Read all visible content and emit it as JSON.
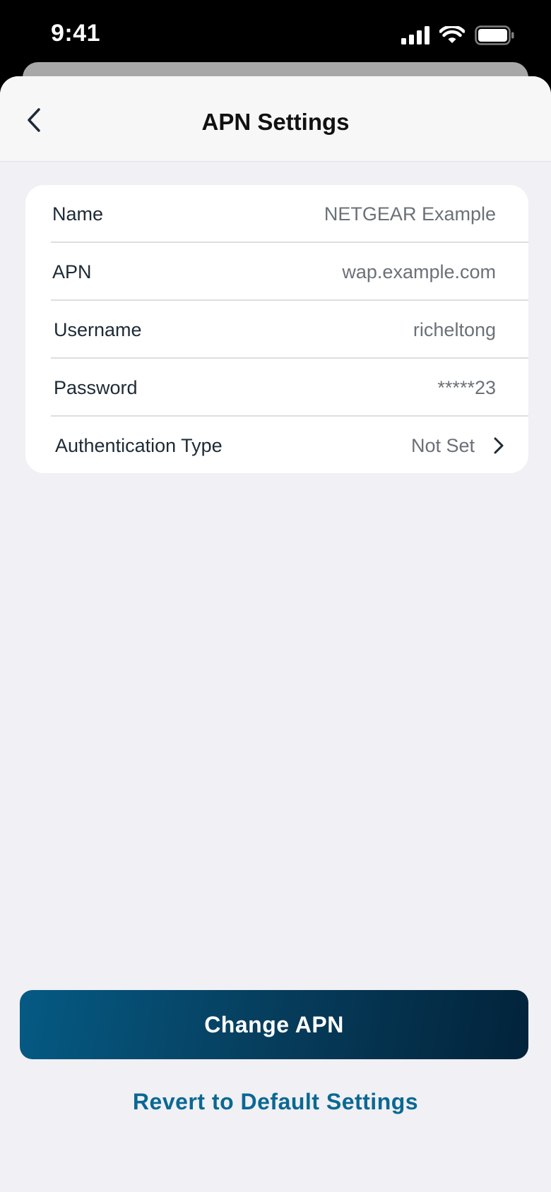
{
  "status_bar": {
    "time": "9:41"
  },
  "nav": {
    "title": "APN Settings"
  },
  "settings": [
    {
      "label": "Name",
      "value": "NETGEAR Example"
    },
    {
      "label": "APN",
      "value": "wap.example.com"
    },
    {
      "label": "Username",
      "value": "richeltong"
    },
    {
      "label": "Password",
      "value": "*****23"
    },
    {
      "label": "Authentication Type",
      "value": "Not Set"
    }
  ],
  "actions": {
    "primary_label": "Change APN",
    "secondary_label": "Revert to Default Settings"
  },
  "colors": {
    "accent": "#0a6892",
    "button_gradient_start": "#055a84",
    "button_gradient_end": "#02233a",
    "background": "#f0f0f5"
  },
  "icons": {
    "back": "chevron-left-icon",
    "row_disclosure": "chevron-right-icon",
    "signal": "cellular-signal-icon",
    "wifi": "wifi-icon",
    "battery": "battery-icon"
  }
}
